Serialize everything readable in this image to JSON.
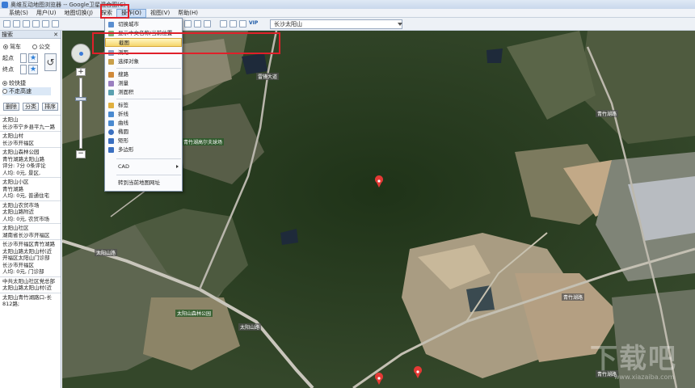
{
  "window": {
    "title": "奥维互动地图浏览器 -- Google卫星混合图(C)"
  },
  "menu": [
    "系统(S)",
    "用户(U)",
    "地图切换(J)",
    "探索",
    "操作(O)",
    "视图(V)",
    "帮助(H)"
  ],
  "toolbar": {
    "address_value": "长沙太阳山",
    "vip_label": "VIP"
  },
  "sidebar": {
    "header": "搜索",
    "close": "✕",
    "mode_drive": "驾车",
    "mode_bus": "公交",
    "start_label": "起点",
    "end_label": "终点",
    "opt_fast": "较快捷",
    "opt_nohighway": "不走高速",
    "buttons": [
      "删除",
      "分类",
      "排序"
    ],
    "results": [
      [
        "太阳山",
        "长沙市宁乡县平九一路"
      ],
      [
        "太阳山村",
        "长沙市开福区"
      ],
      [
        "太阳山森林公园",
        "青竹湖路太阳山路",
        "评分: 7分 0条评论",
        "人均: 0元, 景区,"
      ],
      [
        "太阳山小区",
        "青竹湖路",
        "人均: 0元, 普通住宅"
      ],
      [
        "太阳山农贸市场",
        "太阳山路附近",
        "人均: 0元, 农贸市场"
      ],
      [
        "太阳山社区",
        "湖南省长沙市开福区"
      ],
      [
        "长沙市开福区青竹湖路",
        "太阳山路太阳山村(近",
        "开福区太阳山门诊部",
        "长沙市开福区",
        "人均: 0元, 门诊部"
      ],
      [
        "中共太阳山社区党总部",
        "太阳山路太阳山村(近"
      ],
      [
        "太阳山青竹湖路口-长",
        "812路;"
      ]
    ]
  },
  "dropdown": {
    "items": [
      "切换城市",
      "显示中文名称/当前位置",
      "截图",
      "测距",
      "选择对象",
      "搜路",
      "测量",
      "测面积",
      "标签",
      "折线",
      "曲线",
      "椭圆",
      "矩形",
      "多边形",
      "CAD",
      "转到当前地图网址"
    ],
    "selected": "截图"
  },
  "map": {
    "labels": [
      "青竹湖高尔夫球场",
      "太阳山森林公园",
      "太阳山路",
      "太阳山路",
      "雷锋大道",
      "青竹湖路",
      "青竹湖路",
      "青竹湖路"
    ],
    "zoom_plus": "+",
    "zoom_minus": "−"
  },
  "watermark": {
    "main": "下载吧",
    "sub": "www.xiazaiba.com"
  }
}
